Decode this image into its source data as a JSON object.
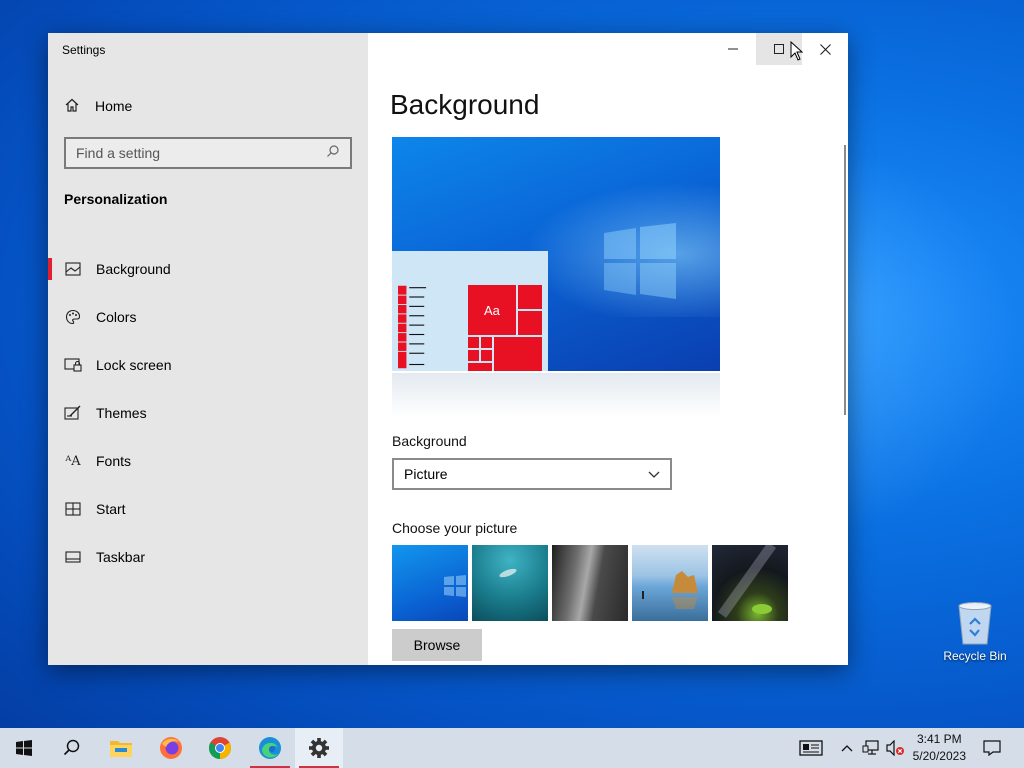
{
  "window": {
    "title": "Settings",
    "controls": {
      "minimize": "—",
      "maximize": "☐",
      "close": "✕"
    }
  },
  "sidebar": {
    "home_label": "Home",
    "search_placeholder": "Find a setting",
    "section_title": "Personalization",
    "items": [
      {
        "label": "Background",
        "icon": "image-icon",
        "active": true
      },
      {
        "label": "Colors",
        "icon": "palette-icon",
        "active": false
      },
      {
        "label": "Lock screen",
        "icon": "lock-screen-icon",
        "active": false
      },
      {
        "label": "Themes",
        "icon": "themes-icon",
        "active": false
      },
      {
        "label": "Fonts",
        "icon": "fonts-icon",
        "active": false
      },
      {
        "label": "Start",
        "icon": "start-icon",
        "active": false
      },
      {
        "label": "Taskbar",
        "icon": "taskbar-icon",
        "active": false
      }
    ]
  },
  "main": {
    "page_title": "Background",
    "preview": {
      "sample_text": "Aa"
    },
    "background_label": "Background",
    "background_value": "Picture",
    "choose_picture_label": "Choose your picture",
    "browse_label": "Browse"
  },
  "desktop": {
    "recycle_bin_label": "Recycle Bin"
  },
  "taskbar": {
    "apps": [
      "start-icon",
      "search-icon",
      "file-explorer-icon",
      "firefox-icon",
      "chrome-icon",
      "edge-icon",
      "settings-icon"
    ],
    "time": "3:41 PM",
    "date": "5/20/2023"
  },
  "colors": {
    "accent": "#e0202e",
    "desktop_blue": "#0a6fe0",
    "sidebar_bg": "#e6e6e6"
  }
}
